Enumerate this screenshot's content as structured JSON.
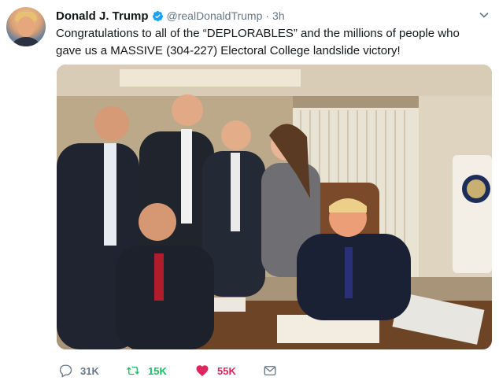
{
  "tweet": {
    "author_name": "Donald J. Trump",
    "handle": "@realDonaldTrump",
    "separator": "·",
    "time": "3h",
    "verified_icon": "verified-badge-icon",
    "menu_icon": "chevron-down-icon",
    "text_line1": "Congratulations to all of the “DEPLORABLES” and the millions of people who",
    "text_line2": "gave us a MASSIVE (304-227) Electoral College landslide victory!",
    "photo_icon": "attached-photo"
  },
  "actions": {
    "reply": {
      "icon": "reply-icon",
      "count": "31K"
    },
    "retweet": {
      "icon": "retweet-icon",
      "count": "15K"
    },
    "like": {
      "icon": "heart-icon",
      "count": "55K"
    },
    "dm": {
      "icon": "mail-icon"
    }
  },
  "colors": {
    "text": "#14171a",
    "secondary": "#657786",
    "retweet": "#17bf63",
    "like": "#e0245e",
    "verified": "#1da1f2"
  }
}
